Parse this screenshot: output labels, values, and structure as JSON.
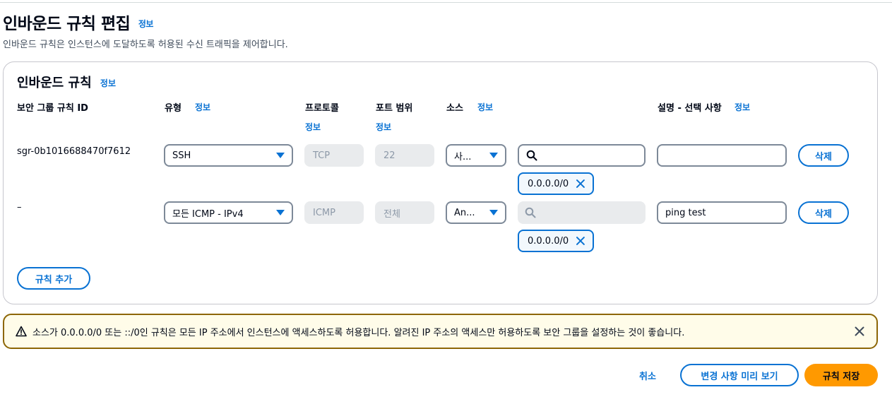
{
  "header": {
    "title": "인바운드 규칙 편집",
    "info": "정보",
    "description": "인바운드 규칙은 인스턴스에 도달하도록 허용된 수신 트래픽을 제어합니다."
  },
  "panel": {
    "title": "인바운드 규칙",
    "info": "정보",
    "columns": {
      "rule_id": "보안 그룹 규칙 ID",
      "type": "유형",
      "type_info": "정보",
      "protocol": "프로토콜",
      "protocol_info": "정보",
      "port_range": "포트 범위",
      "port_info": "정보",
      "source": "소스",
      "source_info": "정보",
      "description": "설명 - 선택 사항",
      "description_info": "정보"
    },
    "rules": [
      {
        "rule_id": "sgr-0b1016688470f7612",
        "type": "SSH",
        "protocol": "TCP",
        "port_range": "22",
        "source_type": "사...",
        "search_value": "",
        "cidr_token": "0.0.0.0/0",
        "description": "",
        "delete_label": "삭제"
      },
      {
        "rule_id": "–",
        "type": "모든 ICMP - IPv4",
        "protocol": "ICMP",
        "port_range": "전체",
        "source_type": "An...",
        "search_value": "",
        "cidr_token": "0.0.0.0/0",
        "description": "ping test",
        "delete_label": "삭제"
      }
    ],
    "add_rule_label": "규칙 추가"
  },
  "alert": {
    "text": "소스가 0.0.0.0/0 또는 ::/0인 규칙은 모든 IP 주소에서 인스턴스에 액세스하도록 허용합니다. 알려진 IP 주소의 액세스만 허용하도록 보안 그룹을 설정하는 것이 좋습니다."
  },
  "footer": {
    "cancel_label": "취소",
    "preview_label": "변경 사항 미리 보기",
    "save_label": "규칙 저장"
  },
  "colors": {
    "accent": "#0972d3",
    "primary_button": "#ff9900",
    "warning_border": "#8d6605",
    "warning_bg": "#fffce9"
  }
}
